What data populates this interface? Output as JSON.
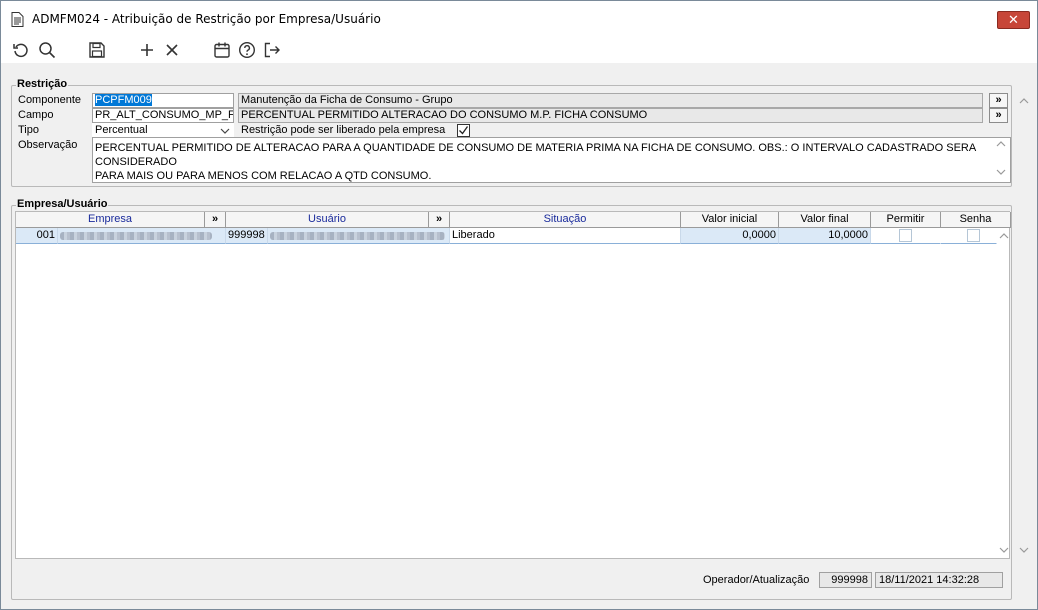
{
  "window": {
    "title": "ADMFM024 - Atribuição de Restrição por Empresa/Usuário",
    "close_glyph": "✕"
  },
  "toolbar": {
    "icons": [
      "refresh-icon",
      "search-icon",
      "save-icon",
      "add-icon",
      "delete-icon",
      "calendar-icon",
      "help-icon",
      "exit-icon"
    ]
  },
  "restricao": {
    "group_label": "Restrição",
    "componente_label": "Componente",
    "componente_value": "PCPFM009",
    "componente_desc": "Manutenção da Ficha de Consumo - Grupo",
    "campo_label": "Campo",
    "campo_value": "PR_ALT_CONSUMO_MP_FC",
    "campo_desc": "PERCENTUAL PERMITIDO ALTERACAO DO CONSUMO M.P. FICHA CONSUMO",
    "tipo_label": "Tipo",
    "tipo_value": "Percentual",
    "liberado_label": "Restrição pode ser liberado pela empresa",
    "liberado_checked": true,
    "observacao_label": "Observação",
    "observacao_line1": "PERCENTUAL PERMITIDO DE ALTERACAO PARA A QUANTIDADE DE CONSUMO DE MATERIA PRIMA NA FICHA DE CONSUMO. OBS.: O INTERVALO CADASTRADO SERA CONSIDERADO",
    "observacao_line2": "PARA MAIS OU PARA MENOS COM RELACAO A QTD CONSUMO.",
    "expand_glyph": "»"
  },
  "empresa_usuario": {
    "group_label": "Empresa/Usuário",
    "columns": {
      "empresa": "Empresa",
      "usuario": "Usuário",
      "situacao": "Situação",
      "valor_inicial": "Valor inicial",
      "valor_final": "Valor final",
      "permitir": "Permitir",
      "senha": "Senha",
      "expand": "»"
    },
    "rows": [
      {
        "empresa_code": "001",
        "usuario_code": "999998",
        "situacao": "Liberado",
        "valor_inicial": "0,0000",
        "valor_final": "10,0000",
        "permitir": false,
        "senha": false
      }
    ]
  },
  "footer": {
    "operador_label": "Operador/Atualização",
    "operador_code": "999998",
    "atualizacao": "18/11/2021 14:32:28"
  },
  "colors": {
    "selection_blue": "#0078d7",
    "row_highlight": "#dbe9f7",
    "header_text_blue": "#1a2b9c",
    "close_red": "#c74638"
  }
}
